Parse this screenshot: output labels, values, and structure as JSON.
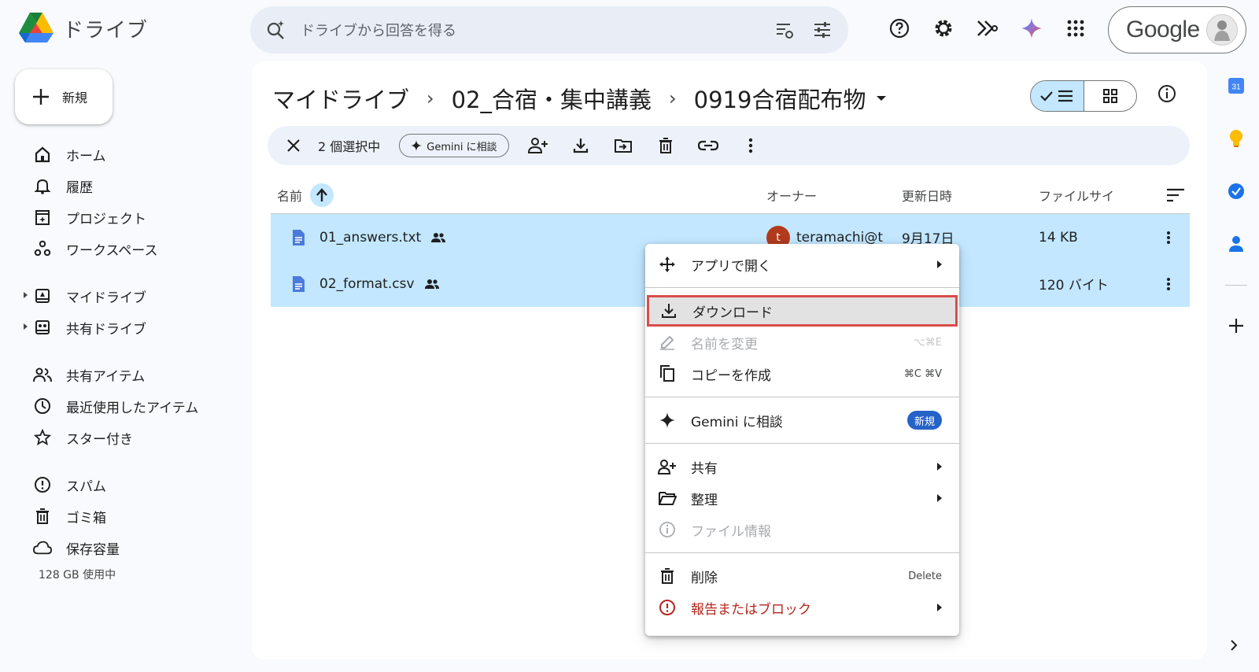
{
  "app": {
    "name": "ドライブ"
  },
  "search": {
    "placeholder": "ドライブから回答を得る"
  },
  "account": {
    "brand": "Google"
  },
  "sidebar": {
    "new_label": "新規",
    "items": [
      {
        "label": "ホーム",
        "icon": "home-icon"
      },
      {
        "label": "履歴",
        "icon": "bell-icon"
      },
      {
        "label": "プロジェクト",
        "icon": "project-icon"
      },
      {
        "label": "ワークスペース",
        "icon": "workspace-icon"
      },
      {
        "label": "マイドライブ",
        "icon": "my-drive-icon"
      },
      {
        "label": "共有ドライブ",
        "icon": "shared-drive-icon"
      },
      {
        "label": "共有アイテム",
        "icon": "shared-people-icon"
      },
      {
        "label": "最近使用したアイテム",
        "icon": "clock-icon"
      },
      {
        "label": "スター付き",
        "icon": "star-icon"
      },
      {
        "label": "スパム",
        "icon": "spam-icon"
      },
      {
        "label": "ゴミ箱",
        "icon": "trash-icon"
      },
      {
        "label": "保存容量",
        "icon": "cloud-icon"
      }
    ],
    "storage_text": "128 GB 使用中"
  },
  "breadcrumb": {
    "items": [
      "マイドライブ",
      "02_合宿・集中講義",
      "0919合宿配布物"
    ],
    "separator": "›"
  },
  "selection_bar": {
    "count_label": "2 個選択中",
    "gemini_chip": "Gemini に相談"
  },
  "table": {
    "headers": {
      "name": "名前",
      "owner": "オーナー",
      "modified": "更新日時",
      "size": "ファイルサイ"
    },
    "rows": [
      {
        "name": "01_answers.txt",
        "owner": "teramachi@t",
        "owner_initial": "t",
        "modified": "9月17日",
        "size": "14 KB"
      },
      {
        "name": "02_format.csv",
        "owner": "",
        "owner_initial": "",
        "modified": "",
        "size": "120 バイト"
      }
    ]
  },
  "context_menu": {
    "open_with": "アプリで開く",
    "download": "ダウンロード",
    "rename": "名前を変更",
    "rename_shortcut": "⌥⌘E",
    "copy": "コピーを作成",
    "copy_shortcut": "⌘C ⌘V",
    "gemini": "Gemini に相談",
    "gemini_badge": "新規",
    "share": "共有",
    "organize": "整理",
    "file_info": "ファイル情報",
    "delete": "削除",
    "delete_shortcut": "Delete",
    "report": "報告またはブロック"
  },
  "colors": {
    "selected_row": "#c2e7ff",
    "accent_blue": "#2563c9",
    "highlight_outline": "#d94c4c",
    "report_red": "#b3261e"
  }
}
